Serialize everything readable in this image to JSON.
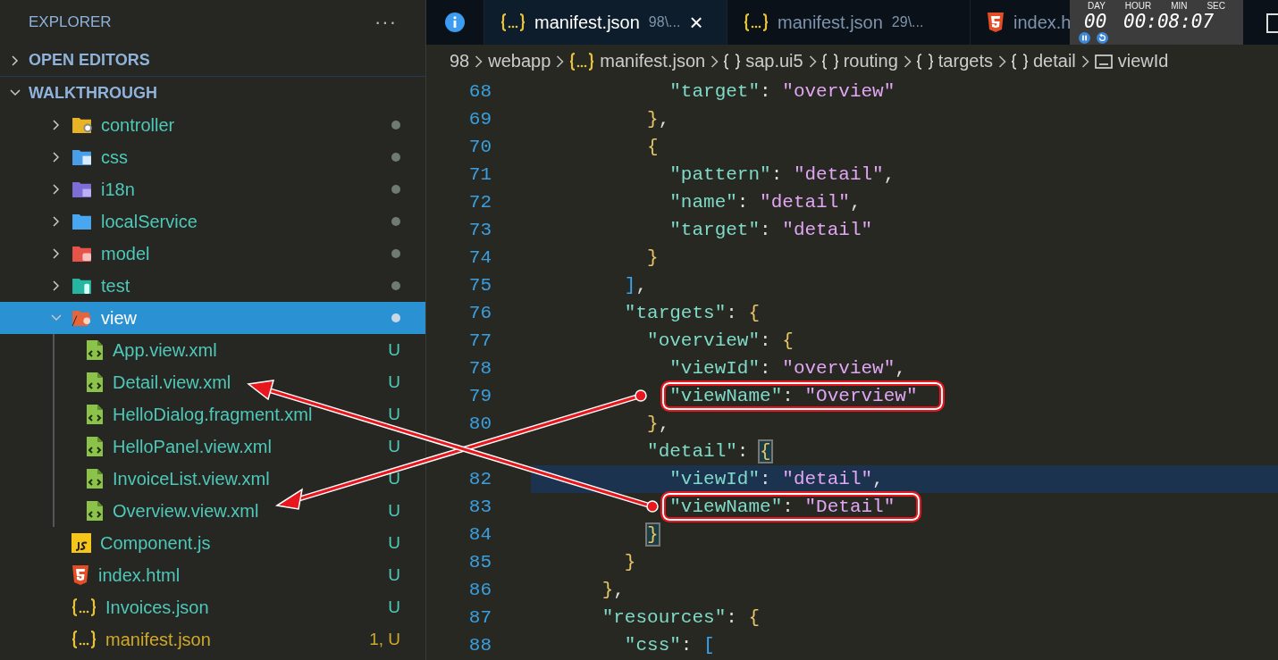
{
  "sidebar": {
    "title": "EXPLORER",
    "more": "···",
    "sections": [
      {
        "label": "OPEN EDITORS",
        "expanded": false
      },
      {
        "label": "WALKTHROUGH",
        "expanded": true
      }
    ],
    "tree": [
      {
        "name": "controller",
        "kind": "controller",
        "color": "#e8b325",
        "expanded": false,
        "selected": false,
        "modified": true
      },
      {
        "name": "css",
        "kind": "css",
        "color": "#4a9ee8",
        "expanded": false,
        "selected": false,
        "modified": true
      },
      {
        "name": "i18n",
        "kind": "i18n",
        "color": "#7c6ed6",
        "expanded": false,
        "selected": false,
        "modified": true
      },
      {
        "name": "localService",
        "kind": "plain",
        "color": "#49a7f0",
        "expanded": false,
        "selected": false,
        "modified": true
      },
      {
        "name": "model",
        "kind": "model",
        "color": "#e5534b",
        "expanded": false,
        "selected": false,
        "modified": true
      },
      {
        "name": "test",
        "kind": "test",
        "color": "#26b5a0",
        "expanded": false,
        "selected": false,
        "modified": true
      },
      {
        "name": "view",
        "kind": "view",
        "color": "#e8643b",
        "expanded": true,
        "selected": true,
        "modified": true,
        "children": [
          {
            "name": "App.view.xml",
            "kind": "xml",
            "badge": "U",
            "warning": false
          },
          {
            "name": "Detail.view.xml",
            "kind": "xml",
            "badge": "U",
            "warning": false
          },
          {
            "name": "HelloDialog.fragment.xml",
            "kind": "xml",
            "badge": "U",
            "warning": false
          },
          {
            "name": "HelloPanel.view.xml",
            "kind": "xml",
            "badge": "U",
            "warning": false
          },
          {
            "name": "InvoiceList.view.xml",
            "kind": "xml",
            "badge": "U",
            "warning": false
          },
          {
            "name": "Overview.view.xml",
            "kind": "xml",
            "badge": "U",
            "warning": false
          }
        ]
      },
      {
        "name": "Component.js",
        "kind": "js",
        "badge": "U",
        "warning": false
      },
      {
        "name": "index.html",
        "kind": "html",
        "badge": "U",
        "warning": false
      },
      {
        "name": "Invoices.json",
        "kind": "json",
        "badge": "U",
        "warning": false
      },
      {
        "name": "manifest.json",
        "kind": "json",
        "badge": "1, U",
        "warning": true
      }
    ]
  },
  "tabs": [
    {
      "kind": "info",
      "selected": false
    },
    {
      "kind": "json",
      "label": "manifest.json",
      "description": "98\\...",
      "selected": true,
      "close": "×"
    },
    {
      "kind": "json",
      "label": "manifest.json",
      "description": "29\\...",
      "selected": false
    },
    {
      "kind": "html",
      "label": "index.h",
      "selected": false
    }
  ],
  "timer": {
    "labels": [
      "DAY",
      "HOUR",
      "MIN",
      "SEC"
    ],
    "day": "00",
    "time": "00:08:07"
  },
  "breadcrumb": [
    {
      "label": "98",
      "kind": "none"
    },
    {
      "label": "webapp",
      "kind": "none"
    },
    {
      "label": "manifest.json",
      "kind": "json"
    },
    {
      "label": "sap.ui5",
      "kind": "object"
    },
    {
      "label": "routing",
      "kind": "object"
    },
    {
      "label": "targets",
      "kind": "object"
    },
    {
      "label": "detail",
      "kind": "object"
    },
    {
      "label": "viewId",
      "kind": "string"
    }
  ],
  "editor": {
    "lines": [
      {
        "number": "68",
        "text": "            \"target\": \"overview\""
      },
      {
        "number": "69",
        "text": "          },"
      },
      {
        "number": "70",
        "text": "          {"
      },
      {
        "number": "71",
        "text": "            \"pattern\": \"detail\","
      },
      {
        "number": "72",
        "text": "            \"name\": \"detail\","
      },
      {
        "number": "73",
        "text": "            \"target\": \"detail\""
      },
      {
        "number": "74",
        "text": "          }"
      },
      {
        "number": "75",
        "text": "        ],"
      },
      {
        "number": "76",
        "text": "        \"targets\": {"
      },
      {
        "number": "77",
        "text": "          \"overview\": {"
      },
      {
        "number": "78",
        "text": "            \"viewId\": \"overview\","
      },
      {
        "number": "79",
        "text": "            \"viewName\": \"Overview\"",
        "boxed": true
      },
      {
        "number": "80",
        "text": "          },"
      },
      {
        "text": "          \"detail\": {",
        "bracket_match": true
      },
      {
        "number": "82",
        "text": "            \"viewId\": \"detail\",",
        "current": true
      },
      {
        "number": "83",
        "text": "            \"viewName\": \"Detail\"",
        "boxed": true
      },
      {
        "number": "84",
        "text": "          }",
        "bracket_match": true
      },
      {
        "number": "85",
        "text": "        }"
      },
      {
        "number": "86",
        "text": "      },"
      },
      {
        "number": "87",
        "text": "      \"resources\": {"
      },
      {
        "number": "88",
        "text": "        \"css\": ["
      }
    ]
  }
}
